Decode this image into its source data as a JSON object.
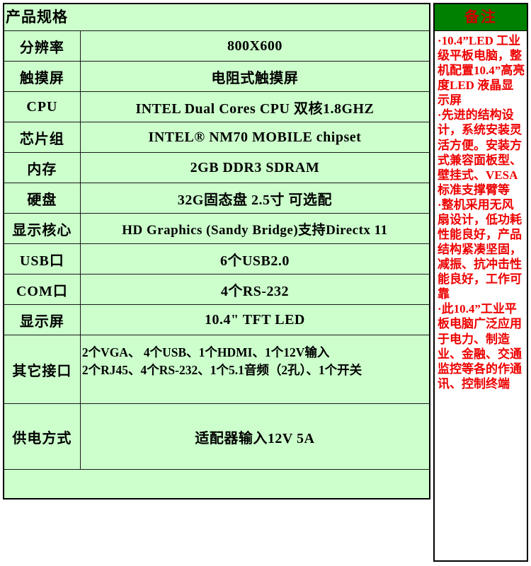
{
  "spec_table": {
    "header": {
      "title": "产品规格"
    },
    "columns": {
      "label_header": "产品规格",
      "value_header": ""
    },
    "rows": [
      {
        "label": "分辨率",
        "value": "800X600"
      },
      {
        "label": "触摸屏",
        "value": "电阻式触摸屏"
      },
      {
        "label": "CPU",
        "value": "INTEL Dual Cores CPU 双核1.8GHZ"
      },
      {
        "label": "芯片组",
        "value": "INTEL® NM70 MOBILE chipset"
      },
      {
        "label": "内存",
        "value": "2GB DDR3 SDRAM"
      },
      {
        "label": "硬盘",
        "value": "32G固态盘 2.5寸 可选配"
      },
      {
        "label": "显示核心",
        "value": "HD Graphics (Sandy Bridge)支持Directx 11"
      },
      {
        "label": "USB口",
        "value": "6个USB2.0"
      },
      {
        "label": "COM口",
        "value": "4个RS-232"
      },
      {
        "label": "显示屏",
        "value": "10.4\" TFT   LED"
      }
    ],
    "ports_row": {
      "label": "其它接口",
      "line1": "2个VGA、  4个USB、1个HDMI、1个12V输入",
      "line2": "2个RJ45、4个RS-232、1个5.1音频（2孔）、1个开关"
    },
    "power_row": {
      "label": "供电方式",
      "value": "适配器输入12V 5A"
    }
  },
  "notes": {
    "title": "备注",
    "paragraphs": [
      "·10.4”LED 工业级平板电脑，整机配置10.4”高亮度LED 液晶显示屏",
      "·先进的结构设计，系统安装灵活方便。安装方式兼容面板型、壁挂式、VESA 标准支撑臂等",
      "·整机采用无风扇设计，低功耗性能良好，产品结构紧凑坚固，减振、抗冲击性能良好，工作可靠",
      "·此10.4”工业平板电脑广泛应用于电力、制造业、金融、交通监控等各的作通讯、控制终端"
    ]
  },
  "colors": {
    "header_green": "#008000",
    "cell_green": "#ccffcc",
    "note_red": "#ee0000",
    "title_red": "#cc0000",
    "border_black": "#000000",
    "page_white": "#ffffff"
  }
}
